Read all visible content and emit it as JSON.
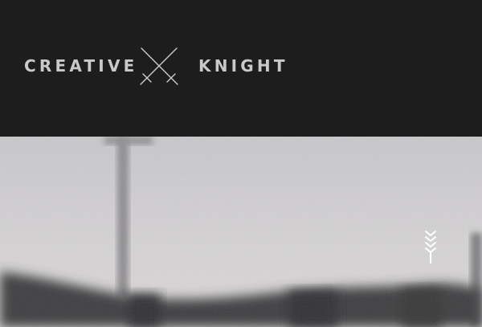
{
  "header": {
    "logo_left": "CREATIVE",
    "logo_right": "KNIGHT",
    "logo_icon": "crossed-swords-icon"
  },
  "hero": {
    "menu_icon": "wheat-icon",
    "colors": {
      "sky": "#cfcdd0",
      "silhouette": "#3a3a3c"
    }
  }
}
